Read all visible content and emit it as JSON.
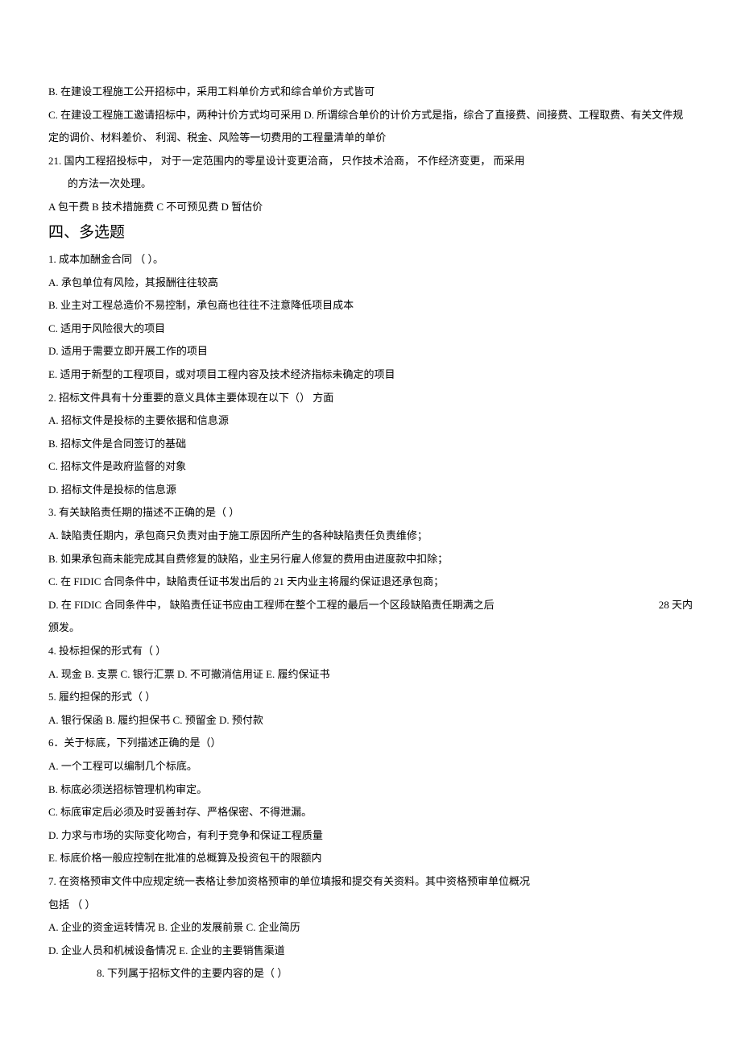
{
  "lines": {
    "preB": "B. 在建设工程施工公开招标中，采用工料单价方式和综合单价方式皆可",
    "preC": "C. 在建设工程施工邀请招标中，两种计价方式均可采用 D. 所谓综合单价的计价方式是指，综合了直接费、间接费、工程取费、有关文件规定的调价、材料差价、 利润、税金、风险等一切费用的工程量清单的单价",
    "q21a": "21. 国内工程招投标中， 对于一定范围内的零星设计变更洽商， 只作技术洽商， 不作经济变更， 而采用",
    "q21b": "的方法一次处理。",
    "q21opts": "A 包干费 B 技术措施费 C 不可预见费 D 暂估价"
  },
  "sectionTitle": "四、多选题",
  "mcq": {
    "q1": {
      "stem": "1. 成本加酬金合同 （ ）。",
      "A": "A. 承包单位有风险，其报酬往往较高",
      "B": "B. 业主对工程总造价不易控制，承包商也往往不注意降低项目成本",
      "C": "C. 适用于风险很大的项目",
      "D": "D. 适用于需要立即开展工作的项目",
      "E": "E. 适用于新型的工程项目，或对项目工程内容及技术经济指标未确定的项目"
    },
    "q2": {
      "stem": "2. 招标文件具有十分重要的意义具体主要体现在以下（） 方面",
      "A": "A. 招标文件是投标的主要依据和信息源",
      "B": "B. 招标文件是合同签订的基础",
      "C": "C. 招标文件是政府监督的对象",
      "D": "D. 招标文件是投标的信息源"
    },
    "q3": {
      "stem": "3. 有关缺陷责任期的描述不正确的是（ ）",
      "A": "A. 缺陷责任期内，承包商只负责对由于施工原因所产生的各种缺陷责任负责维修；",
      "B": "B. 如果承包商未能完成其自费修复的缺陷，业主另行雇人修复的费用由进度款中扣除；",
      "C": "C. 在 FIDIC 合同条件中，缺陷责任证书发出后的 21 天内业主将履约保证退还承包商；",
      "D_left": "D. 在 FIDIC 合同条件中， 缺陷责任证书应由工程师在整个工程的最后一个区段缺陷责任期满之后",
      "D_right": "28 天内",
      "D_tail": "颁发。"
    },
    "q4": {
      "stem": "4. 投标担保的形式有（ ）",
      "opts": "A. 现金 B. 支票 C. 银行汇票 D. 不可撤消信用证 E. 履约保证书"
    },
    "q5": {
      "stem": "5. 履约担保的形式（ ）",
      "opts": "A. 银行保函 B. 履约担保书 C. 预留金 D. 预付款"
    },
    "q6": {
      "stem": "6．关于标底，下列描述正确的是（）",
      "A": "A. 一个工程可以编制几个标底。",
      "B": "B. 标底必须送招标管理机构审定。",
      "C": "C. 标底审定后必须及时妥善封存、严格保密、不得泄漏。",
      "D": "D. 力求与市场的实际变化吻合，有利于竞争和保证工程质量",
      "E": "E. 标底价格一般应控制在批准的总概算及投资包干的限额内"
    },
    "q7": {
      "stem": "7. 在资格预审文件中应规定统一表格让参加资格预审的单位填报和提交有关资料。其中资格预审单位概况",
      "stem2": "包括 （ ）",
      "opts1": "A. 企业的资金运转情况 B. 企业的发展前景 C. 企业简历",
      "opts2": "D. 企业人员和机械设备情况 E. 企业的主要销售渠道"
    },
    "q8": {
      "stem": "8. 下列属于招标文件的主要内容的是（ ）"
    }
  }
}
